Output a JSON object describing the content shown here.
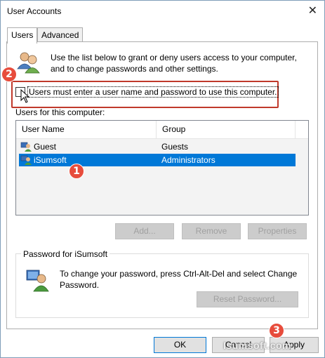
{
  "window": {
    "title": "User Accounts",
    "close_glyph": "✕"
  },
  "tabs": [
    {
      "label": "Users",
      "active": true
    },
    {
      "label": "Advanced",
      "active": false
    }
  ],
  "intro_text": "Use the list below to grant or deny users access to your computer, and to change passwords and other settings.",
  "checkbox": {
    "label": "Users must enter a user name and password to use this computer.",
    "checked": false
  },
  "list": {
    "label": "Users for this computer:",
    "columns": [
      "User Name",
      "Group"
    ],
    "rows": [
      {
        "name": "Guest",
        "group": "Guests",
        "selected": false
      },
      {
        "name": "iSumsoft",
        "group": "Administrators",
        "selected": true
      }
    ]
  },
  "buttons": {
    "add": "Add...",
    "remove": "Remove",
    "properties": "Properties"
  },
  "password": {
    "group_title": "Password for iSumsoft",
    "text": "To change your password, press Ctrl-Alt-Del and select Change Password.",
    "reset": "Reset Password..."
  },
  "footer": {
    "ok": "OK",
    "cancel": "Cancel",
    "apply": "Apply"
  },
  "markers": {
    "one": "1",
    "two": "2",
    "three": "3"
  },
  "watermark": "Isumsoft.com",
  "colors": {
    "selection": "#0078d7",
    "marker": "#e74c3c",
    "highlight_box": "#c0392b"
  },
  "icons": {
    "users": "users-icon",
    "user": "user-icon",
    "password": "password-user-icon",
    "close": "close-icon"
  }
}
